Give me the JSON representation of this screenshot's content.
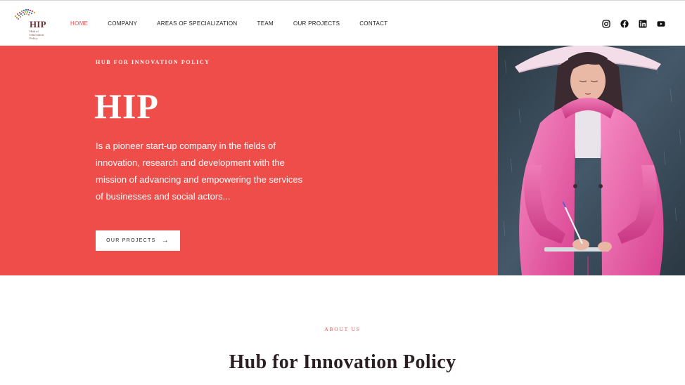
{
  "brand": {
    "logo_word": "HIP",
    "logo_sub": "Hub of Innovation Policy"
  },
  "nav": {
    "items": [
      {
        "label": "HOME",
        "active": true
      },
      {
        "label": "COMPANY",
        "active": false
      },
      {
        "label": "AREAS OF SPECIALIZATION",
        "active": false
      },
      {
        "label": "TEAM",
        "active": false
      },
      {
        "label": "OUR PROJECTS",
        "active": false
      },
      {
        "label": "CONTACT",
        "active": false
      }
    ]
  },
  "social": {
    "icons": [
      "instagram-icon",
      "facebook-icon",
      "linkedin-icon",
      "youtube-icon"
    ]
  },
  "hero": {
    "kicker": "HUB FOR INNOVATION POLICY",
    "title": "HIP",
    "text": "Is a pioneer start-up company in the fields of innovation, research and development with the mission of advancing and empowering the services of businesses and social actors...",
    "button_label": "OUR PROJECTS",
    "button_arrow": "→",
    "background": "#ef4d4a"
  },
  "about": {
    "kicker": "ABOUT US",
    "title": "Hub for Innovation Policy"
  },
  "colors": {
    "accent": "#ef4d4a",
    "heading": "#2b1f24"
  }
}
